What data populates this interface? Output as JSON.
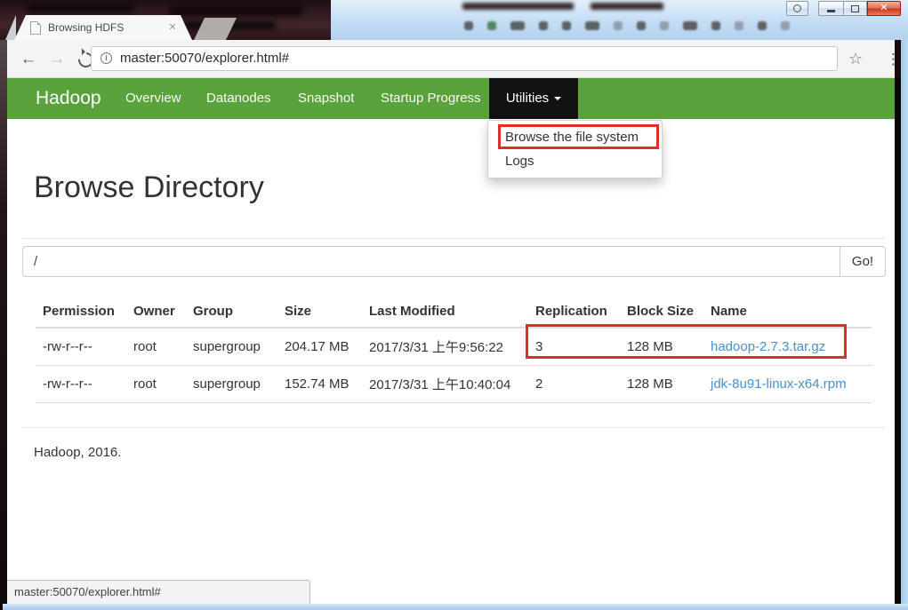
{
  "browser": {
    "tab_title": "Browsing HDFS",
    "url": "master:50070/explorer.html#",
    "status_text": "master:50070/explorer.html#"
  },
  "icons": {
    "back": "←",
    "forward": "→",
    "star": "☆",
    "menu_dots": "⋮",
    "tab_close": "✕",
    "window_close": "✕",
    "site_info": "i"
  },
  "navbar": {
    "brand": "Hadoop",
    "background_color": "#5aa33c",
    "active_background_color": "#121212",
    "items": [
      {
        "label": "Overview"
      },
      {
        "label": "Datanodes"
      },
      {
        "label": "Snapshot"
      },
      {
        "label": "Startup Progress"
      },
      {
        "label": "Utilities"
      }
    ]
  },
  "utilities_menu": {
    "items": [
      {
        "label": "Browse the file system"
      },
      {
        "label": "Logs"
      }
    ]
  },
  "page": {
    "heading": "Browse Directory",
    "path_value": "/",
    "go_label": "Go!",
    "footer": "Hadoop, 2016."
  },
  "file_table": {
    "headers": [
      "Permission",
      "Owner",
      "Group",
      "Size",
      "Last Modified",
      "Replication",
      "Block Size",
      "Name"
    ],
    "link_color": "#4a90cd",
    "rows": [
      {
        "permission": "-rw-r--r--",
        "owner": "root",
        "group": "supergroup",
        "size": "204.17 MB",
        "modified": "2017/3/31 上午9:56:22",
        "replication": "3",
        "block_size": "128 MB",
        "name": "hadoop-2.7.3.tar.gz"
      },
      {
        "permission": "-rw-r--r--",
        "owner": "root",
        "group": "supergroup",
        "size": "152.74 MB",
        "modified": "2017/3/31 上午10:40:04",
        "replication": "2",
        "block_size": "128 MB",
        "name": "jdk-8u91-linux-x64.rpm"
      }
    ]
  },
  "annotation": {
    "color": "#dc2f27"
  }
}
